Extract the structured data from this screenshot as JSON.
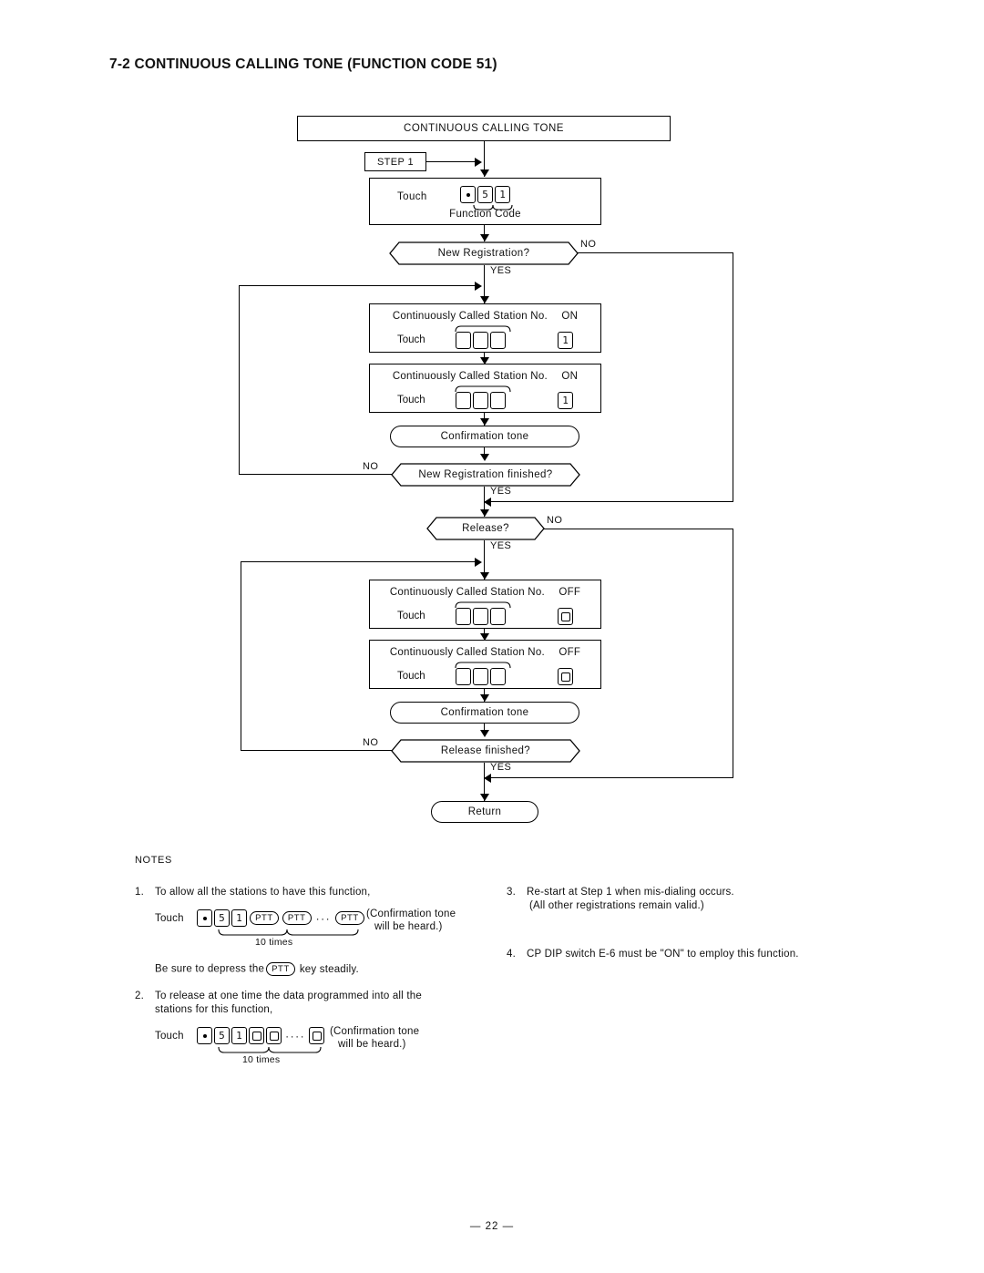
{
  "document": {
    "section_title": "7-2 CONTINUOUS CALLING TONE (FUNCTION CODE 51)",
    "page_number": "— 22 —"
  },
  "flowchart": {
    "title": "CONTINUOUS CALLING TONE",
    "step_tag": "STEP 1",
    "function_code_box": {
      "touch_label": "Touch",
      "caption": "Function Code",
      "keys": [
        "•",
        "5",
        "1"
      ]
    },
    "decisions": {
      "new_registration": "New Registration?",
      "new_registration_finished": "New Registration finished?",
      "release": "Release?",
      "release_finished": "Release finished?"
    },
    "edge_labels": {
      "yes": "YES",
      "no": "NO"
    },
    "station_boxes": [
      {
        "title": "Continuously Called Station No.",
        "state": "ON",
        "touch_label": "Touch",
        "station_keys": [
          "",
          "",
          ""
        ],
        "state_key": "1"
      },
      {
        "title": "Continuously Called Station No.",
        "state": "ON",
        "touch_label": "Touch",
        "station_keys": [
          "",
          "",
          ""
        ],
        "state_key": "1"
      },
      {
        "title": "Continuously Called Station No.",
        "state": "OFF",
        "touch_label": "Touch",
        "station_keys": [
          "",
          "",
          ""
        ],
        "state_key": "0"
      },
      {
        "title": "Continuously Called Station No.",
        "state": "OFF",
        "touch_label": "Touch",
        "station_keys": [
          "",
          "",
          ""
        ],
        "state_key": "0"
      }
    ],
    "confirmation_tone": "Confirmation tone",
    "return_label": "Return"
  },
  "notes": {
    "heading": "NOTES",
    "items": [
      {
        "number": "1.",
        "line1": "To allow all the stations to have this function,",
        "touch_label": "Touch",
        "keys": [
          "•",
          "5",
          "1"
        ],
        "ptt_keys": [
          "PTT",
          "PTT",
          "PTT"
        ],
        "ellipsis": "···",
        "group_label": "10 times",
        "paren_line1": "(Confirmation tone",
        "paren_line2": "will be heard.)",
        "footer": "Be sure to depress the PTT key steadily.",
        "footer_before": "Be sure to depress the",
        "footer_key": "PTT",
        "footer_after": "key steadily."
      },
      {
        "number": "2.",
        "line1": "To release at one time the data programmed into all the",
        "line2": "stations for this function,",
        "touch_label": "Touch",
        "keys": [
          "•",
          "5",
          "1"
        ],
        "zero_keys": [
          "0",
          "0",
          "0"
        ],
        "ellipsis": "····",
        "group_label": "10 times",
        "paren_line1": "(Confirmation tone",
        "paren_line2": "will be heard.)"
      },
      {
        "number": "3.",
        "line1": "Re-start at Step 1 when mis-dialing occurs.",
        "line2": "(All other registrations remain valid.)"
      },
      {
        "number": "4.",
        "line1": "CP DIP switch E-6 must be \"ON\" to employ this function."
      }
    ]
  }
}
